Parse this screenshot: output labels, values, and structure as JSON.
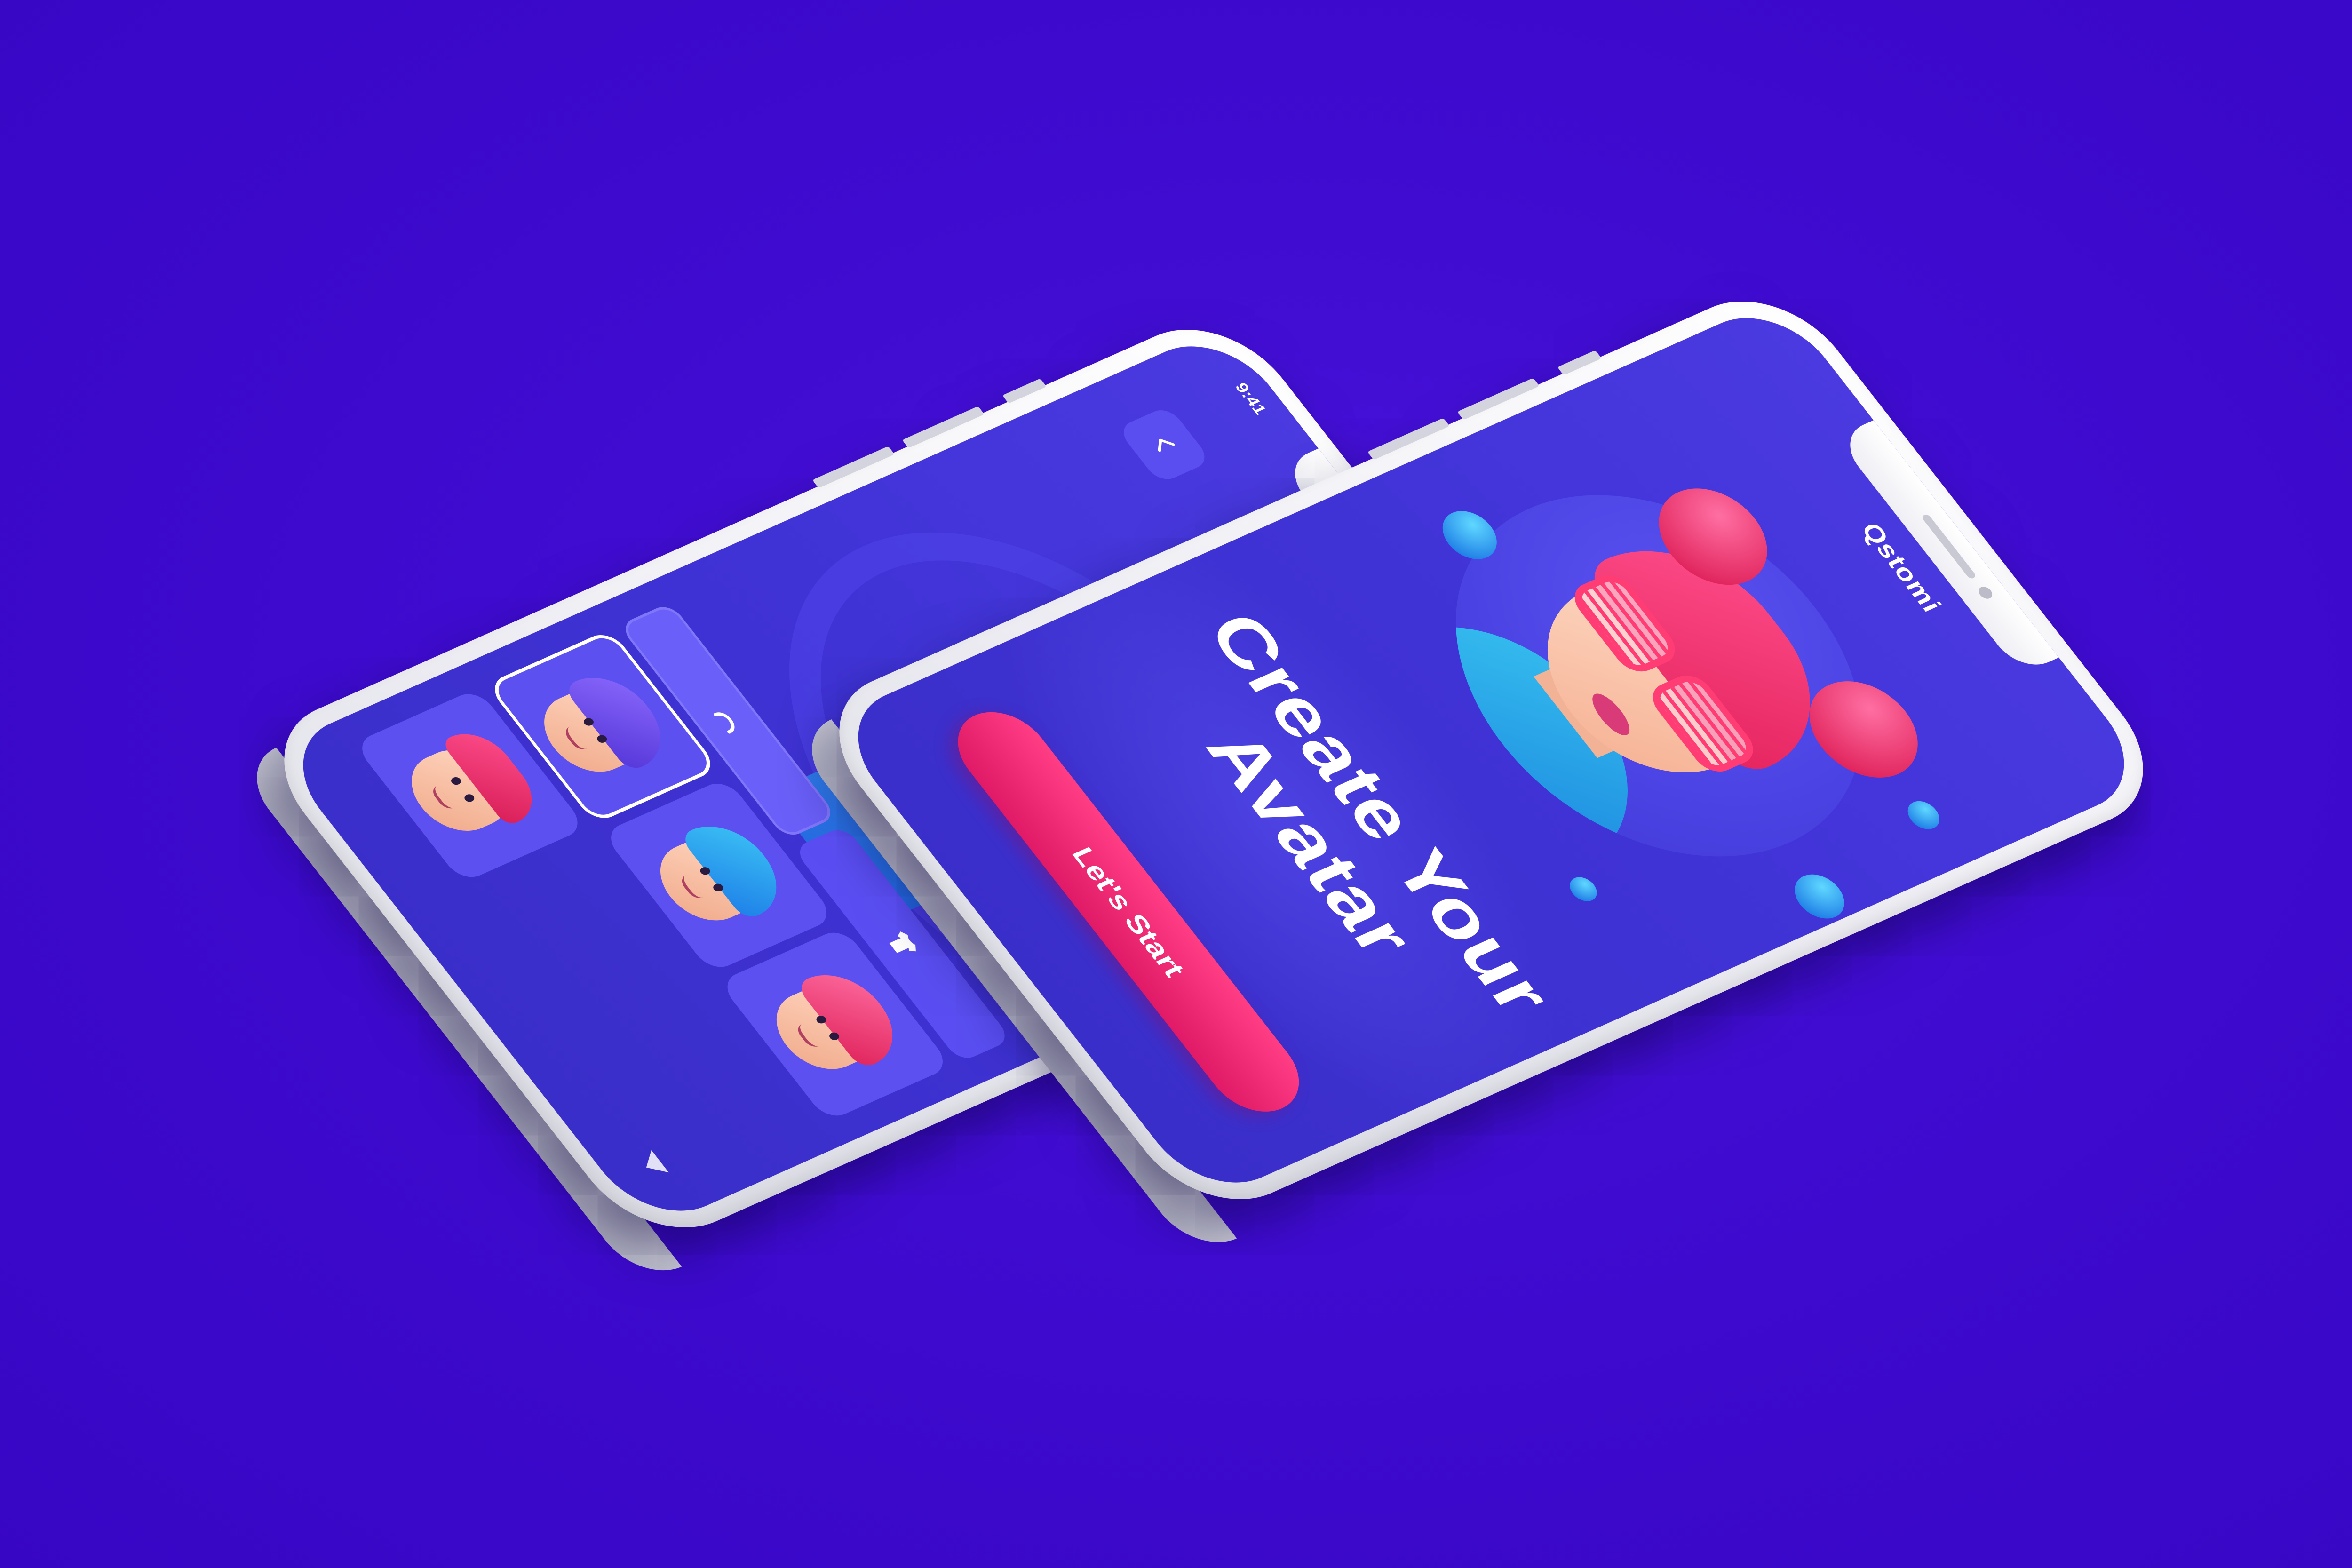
{
  "colors": {
    "background": "#3f0bd0",
    "screen": "#4033d6",
    "panel": "#5a4ef2",
    "accent_pink": "#e01a66",
    "phone_frame": "#f1f1f6"
  },
  "customize_screen": {
    "brand": "Qstomi",
    "status_time": "9:41",
    "status_icons": [
      "signal-icon",
      "wifi-icon",
      "battery-icon"
    ],
    "back_icon": "chevron-left-icon",
    "picker_tabs": [
      "hair-icon",
      "shirt-icon"
    ],
    "avatar_options": [
      {
        "hair": "purple"
      },
      {
        "hair": "blue"
      },
      {
        "hair": "pink"
      },
      {
        "hair": "pink-cap"
      }
    ],
    "scroll_icon": "triangle-down-icon"
  },
  "welcome_screen": {
    "brand": "Qstomi",
    "headline_line1": "Create Your",
    "headline_line2": "Avatar",
    "cta_label": "Let's Start"
  }
}
